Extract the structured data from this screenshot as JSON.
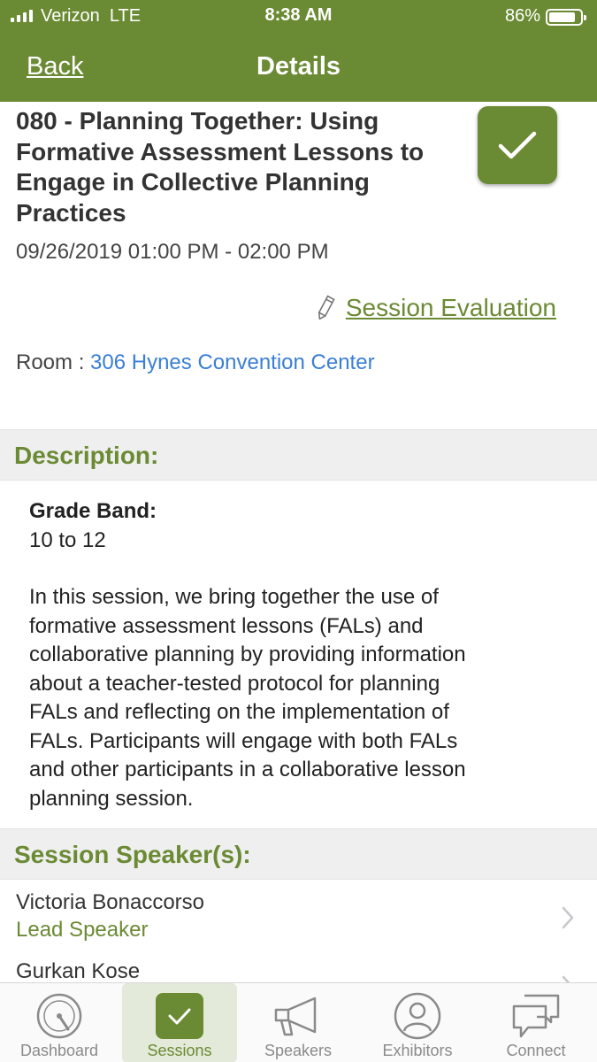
{
  "status_bar": {
    "carrier": "Verizon",
    "network": "LTE",
    "time": "8:38 AM",
    "battery_percent": "86%",
    "battery_level": 0.86
  },
  "nav": {
    "back_label": "Back",
    "title": "Details"
  },
  "session": {
    "title_lines": [
      "080 - Planning Together: Using",
      "Formative Assessment Lessons to",
      "Engage in Collective Planning",
      "Practices"
    ],
    "datetime": "09/26/2019 01:00 PM - 02:00 PM",
    "evaluation_label": "Session Evaluation",
    "room_label": "Room :",
    "room_value": "306 Hynes Convention Center",
    "favorited": true
  },
  "description": {
    "header": "Description:",
    "grade_label": "Grade Band:",
    "grade_value": "10 to 12",
    "paragraph_lines": [
      "In this session, we bring together the use of",
      "formative assessment lessons (FALs) and",
      "collaborative planning by providing information",
      "about a teacher-tested protocol for planning",
      "FALs and reflecting on the implementation of",
      "FALs. Participants will engage with both FALs",
      "and other participants in a collaborative lesson",
      "planning session."
    ]
  },
  "speakers": {
    "header": "Session Speaker(s):",
    "items": [
      {
        "name": "Victoria Bonaccorso",
        "role": "Lead Speaker"
      },
      {
        "name": "Gurkan Kose",
        "role": ""
      }
    ]
  },
  "tabs": [
    {
      "label": "Dashboard",
      "icon": "speedometer-icon",
      "active": false
    },
    {
      "label": "Sessions",
      "icon": "check-icon",
      "active": true
    },
    {
      "label": "Speakers",
      "icon": "megaphone-icon",
      "active": false
    },
    {
      "label": "Exhibitors",
      "icon": "person-icon",
      "active": false
    },
    {
      "label": "Connect",
      "icon": "chat-bubbles-icon",
      "active": false
    }
  ],
  "colors": {
    "brand_green": "#6b8a34",
    "link_blue": "#3a7fd5",
    "section_bg": "#efefef"
  }
}
